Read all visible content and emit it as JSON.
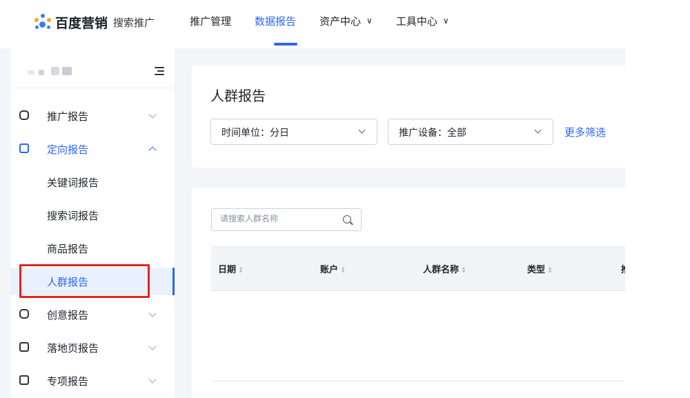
{
  "brand": {
    "name": "百度营销",
    "product": "搜索推广"
  },
  "nav": {
    "items": [
      {
        "label": "推广管理",
        "active": false,
        "dropdown": false
      },
      {
        "label": "数据报告",
        "active": true,
        "dropdown": false
      },
      {
        "label": "资产中心",
        "active": false,
        "dropdown": true
      },
      {
        "label": "工具中心",
        "active": false,
        "dropdown": true
      }
    ],
    "dropdown_glyph": "∨"
  },
  "sidebar": {
    "groups": [
      {
        "label": "推广报告",
        "icon": "chart-icon",
        "expanded": false
      },
      {
        "label": "定向报告",
        "icon": "target-icon",
        "expanded": true,
        "children": [
          "关键词报告",
          "搜索词报告",
          "商品报告",
          "人群报告"
        ]
      },
      {
        "label": "创意报告",
        "icon": "creative-icon",
        "expanded": false
      },
      {
        "label": "落地页报告",
        "icon": "landing-page-icon",
        "expanded": false
      },
      {
        "label": "专项报告",
        "icon": "special-report-icon",
        "expanded": false
      }
    ],
    "active_item": "人群报告"
  },
  "page": {
    "title": "人群报告",
    "filters": {
      "time_unit": "时间单位：分日",
      "device": "推广设备：全部",
      "more": "更多筛选"
    },
    "search": {
      "placeholder": "请搜索人群名称"
    },
    "table": {
      "columns": [
        "日期",
        "账户",
        "人群名称",
        "类型",
        "推"
      ],
      "sort_glyph": "⇕"
    }
  },
  "colors": {
    "accent": "#2c66f5",
    "highlight_box": "#e8231e",
    "page_bg": "#f3f5f9"
  }
}
